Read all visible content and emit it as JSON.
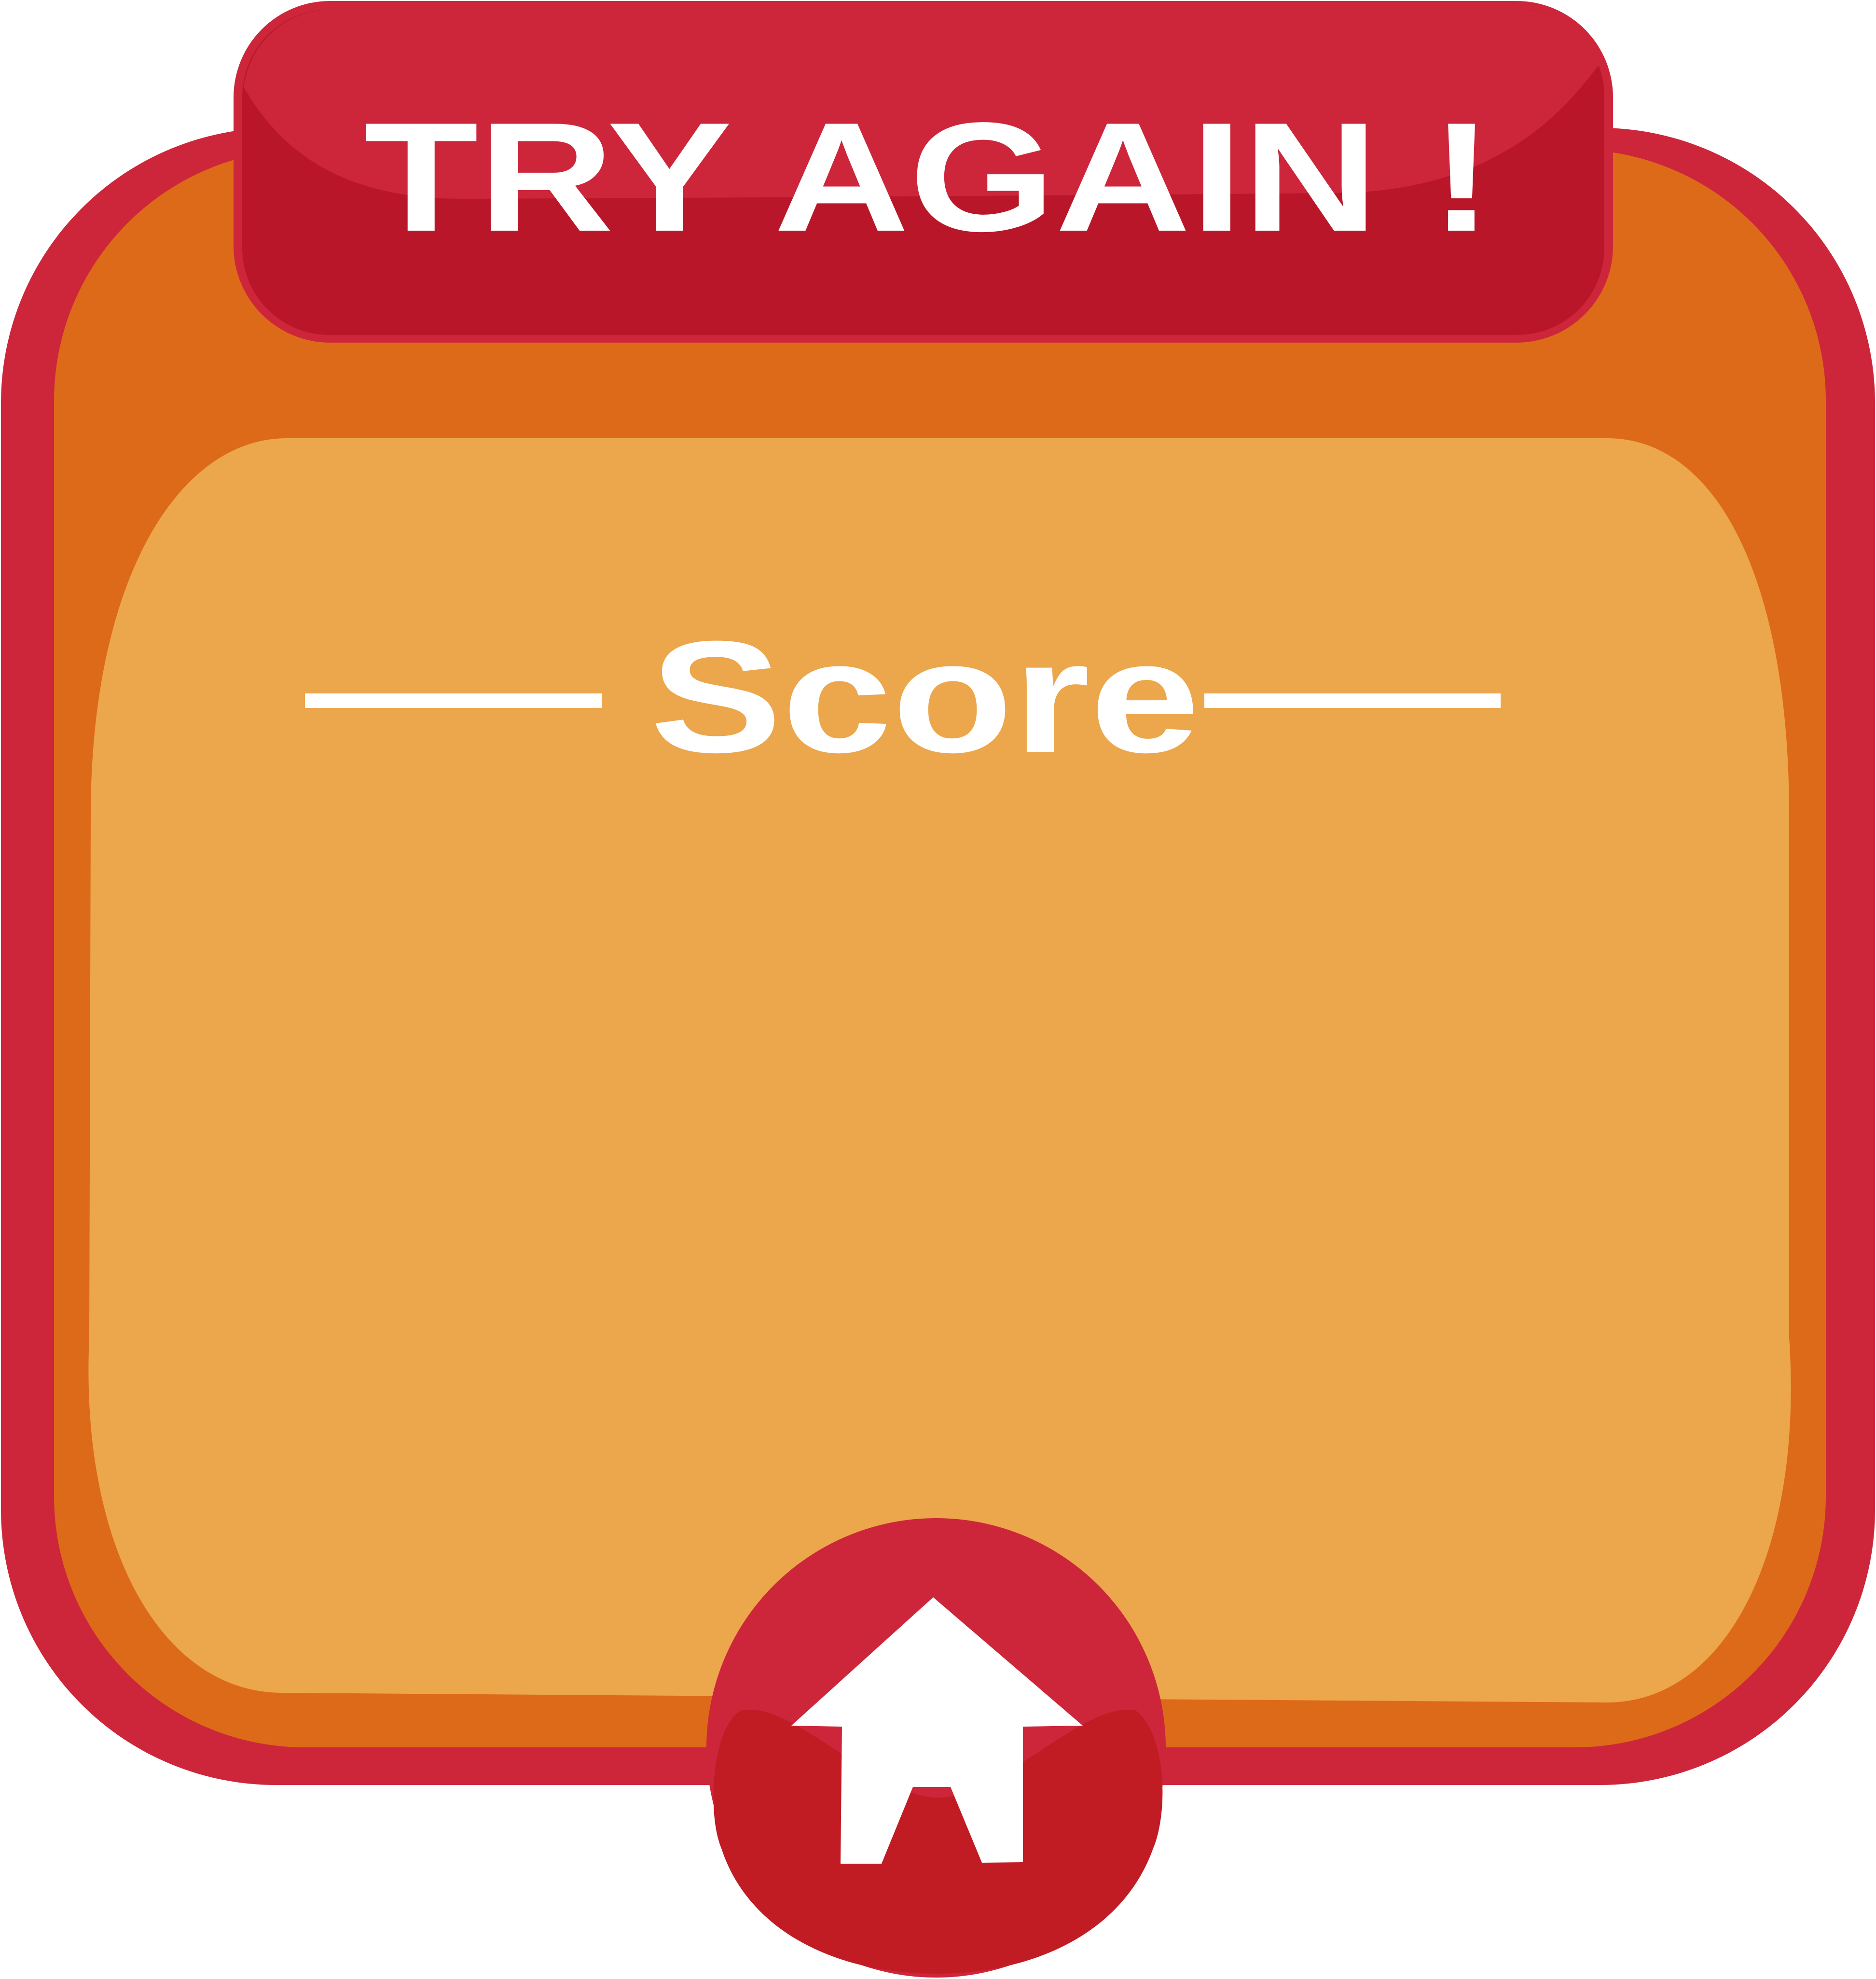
{
  "banner": {
    "title": "TRY AGAIN !"
  },
  "score_panel": {
    "heading": "Score",
    "value": ""
  },
  "home_button": {
    "icon": "house-icon"
  },
  "colors": {
    "frame_red": "#cd263b",
    "banner_dark_red": "#b91729",
    "frame_orange": "#dd6a19",
    "panel_light_orange": "#eca64b",
    "button_dark_red": "#c11b24",
    "text_white": "#ffffff"
  }
}
